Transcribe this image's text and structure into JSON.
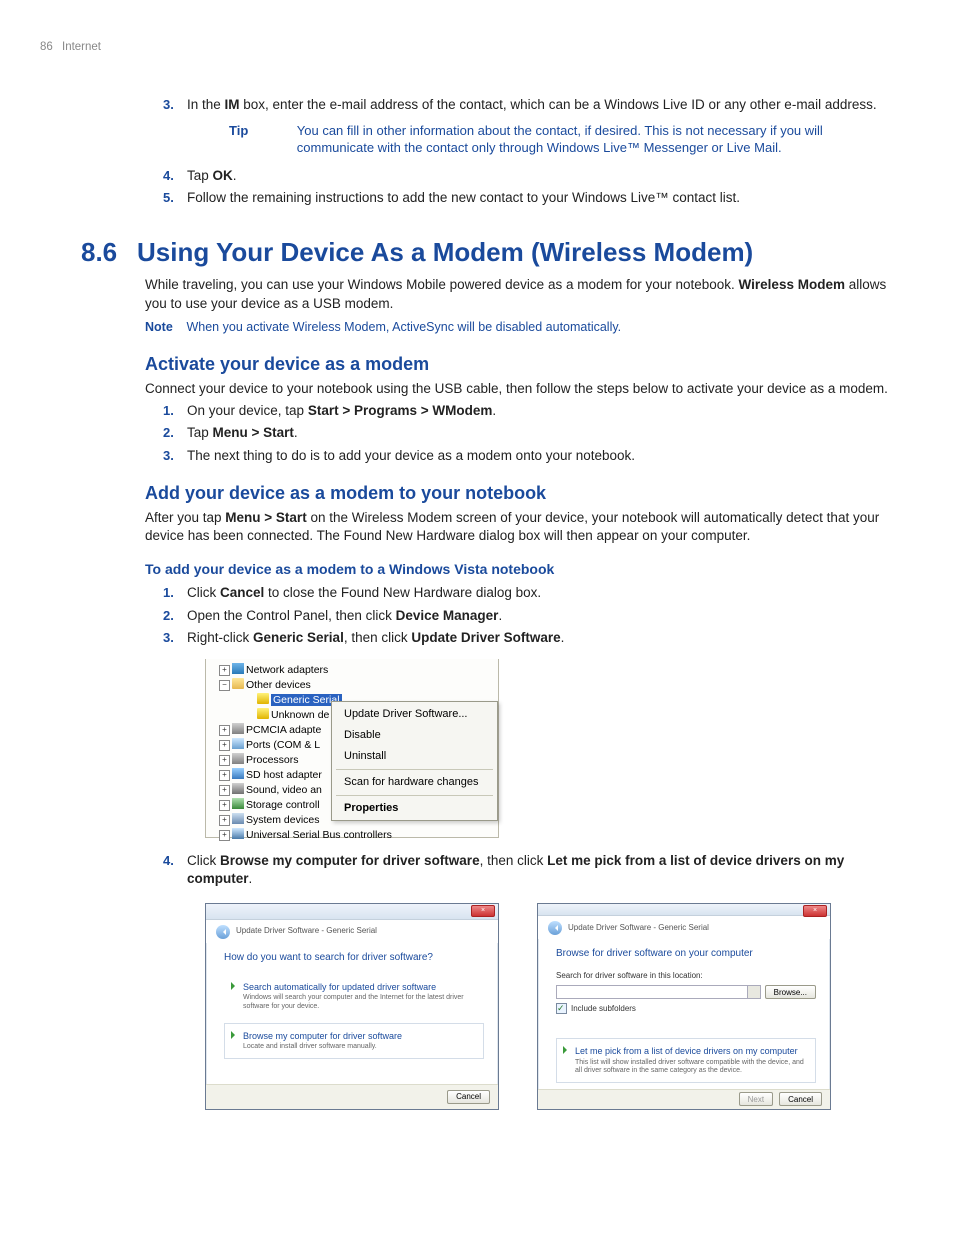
{
  "header": {
    "page_num": "86",
    "section": "Internet"
  },
  "top": {
    "step3_a": "In the ",
    "step3_b": "IM",
    "step3_c": " box, enter the e-mail address of the contact, which can be a Windows Live ID or any other e-mail address.",
    "tip_label": "Tip",
    "tip_body": "You can fill in other information about the contact, if desired. This is not necessary if you will communicate with the contact only through Windows Live™ Messenger or Live Mail.",
    "step4_a": "Tap ",
    "step4_b": "OK",
    "step4_c": ".",
    "step5": "Follow the remaining instructions to add the new contact to your Windows Live™ contact list."
  },
  "h1": {
    "num": "8.6",
    "title": "Using Your Device As a Modem (Wireless Modem)"
  },
  "p1_a": "While traveling, you can use your Windows Mobile powered device as a modem for your notebook. ",
  "p1_b": "Wireless Modem",
  "p1_c": " allows you to use your device as a USB modem.",
  "note": {
    "label": "Note",
    "body": "When you activate Wireless Modem, ActiveSync will be disabled automatically."
  },
  "h2a": "Activate your device as a modem",
  "p2": "Connect your device to your notebook using the USB cable, then follow the steps below to activate your device as a modem.",
  "a_steps": {
    "s1_a": "On your device, tap ",
    "s1_b": "Start > Programs > WModem",
    "s1_c": ".",
    "s2_a": "Tap ",
    "s2_b": "Menu > Start",
    "s2_c": ".",
    "s3": "The next thing to do is to add your device as a modem onto your notebook."
  },
  "h2b": "Add your device as a modem to your notebook",
  "p3_a": "After you tap ",
  "p3_b": "Menu > Start",
  "p3_c": " on the Wireless Modem screen of your device, your notebook will automatically detect that your device has been connected. The Found New Hardware dialog box will then appear on your computer.",
  "h3": "To add your device as a modem to a Windows Vista notebook",
  "b_steps": {
    "s1_a": "Click ",
    "s1_b": "Cancel",
    "s1_c": " to close the Found New Hardware dialog box.",
    "s2_a": "Open the Control Panel, then click ",
    "s2_b": "Device Manager",
    "s2_c": ".",
    "s3_a": "Right-click ",
    "s3_b": "Generic Serial",
    "s3_c": ", then click ",
    "s3_d": "Update Driver Software",
    "s3_e": "."
  },
  "devmgr": {
    "items": {
      "net": "Network adapters",
      "other": "Other devices",
      "generic": "Generic Serial",
      "unknown": "Unknown de",
      "pcmcia": "PCMCIA adapte",
      "ports": "Ports (COM & L",
      "proc": "Processors",
      "sd": "SD host adapter",
      "snd": "Sound, video an",
      "stor": "Storage controll",
      "sys": "System devices",
      "usb": "Universal Serial Bus controllers"
    },
    "ctx": {
      "update": "Update Driver Software...",
      "disable": "Disable",
      "uninstall": "Uninstall",
      "scan": "Scan for hardware changes",
      "props": "Properties"
    }
  },
  "step4": {
    "a": "Click ",
    "b": "Browse my computer for driver software",
    "c": ", then click ",
    "d": "Let me pick from a list of device drivers on my computer",
    "e": "."
  },
  "dlg1": {
    "crumb": "Update Driver Software - Generic Serial",
    "q": "How do you want to search for driver software?",
    "opt1_t": "Search automatically for updated driver software",
    "opt1_d": "Windows will search your computer and the Internet for the latest driver software for your device.",
    "opt2_t": "Browse my computer for driver software",
    "opt2_d": "Locate and install driver software manually.",
    "cancel": "Cancel"
  },
  "dlg2": {
    "crumb": "Update Driver Software - Generic Serial",
    "q": "Browse for driver software on your computer",
    "loc_label": "Search for driver software in this location:",
    "browse": "Browse...",
    "chk": "Include subfolders",
    "opt_t": "Let me pick from a list of device drivers on my computer",
    "opt_d": "This list will show installed driver software compatible with the device, and all driver software in the same category as the device.",
    "next": "Next",
    "cancel": "Cancel"
  }
}
